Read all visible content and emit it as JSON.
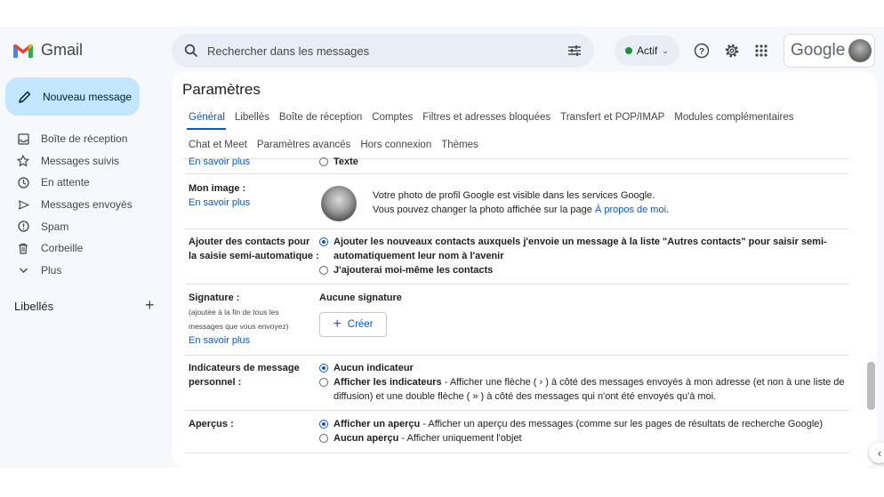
{
  "app": {
    "name": "Gmail"
  },
  "search": {
    "placeholder": "Rechercher dans les messages"
  },
  "status": {
    "label": "Actif"
  },
  "brand": {
    "google": "Google"
  },
  "compose": {
    "label": "Nouveau message"
  },
  "nav": {
    "items": [
      {
        "label": "Boîte de réception",
        "icon": "inbox-icon"
      },
      {
        "label": "Messages suivis",
        "icon": "star-icon"
      },
      {
        "label": "En attente",
        "icon": "clock-icon"
      },
      {
        "label": "Messages envoyés",
        "icon": "send-icon"
      },
      {
        "label": "Spam",
        "icon": "spam-icon"
      },
      {
        "label": "Corbeille",
        "icon": "trash-icon"
      },
      {
        "label": "Plus",
        "icon": "chevron-down-icon"
      }
    ]
  },
  "labels": {
    "title": "Libellés"
  },
  "settings": {
    "title": "Paramètres",
    "tabs_row1": [
      "Général",
      "Libellés",
      "Boîte de réception",
      "Comptes",
      "Filtres et adresses bloquées",
      "Transfert et POP/IMAP",
      "Modules complémentaires"
    ],
    "tabs_row2": [
      "Chat et Meet",
      "Paramètres avancés",
      "Hors connexion",
      "Thèmes"
    ],
    "top": {
      "learn_more": "En savoir plus",
      "option": "Texte"
    },
    "my_image": {
      "label": "Mon image :",
      "learn_more": "En savoir plus",
      "line1": "Votre photo de profil Google est visible dans les services Google.",
      "line2": "Vous pouvez changer la photo affichée sur la page",
      "link": "À propos de moi",
      "period": "."
    },
    "contacts": {
      "label_line1": "Ajouter des contacts pour",
      "label_line2": "la saisie semi-automatique :",
      "opt1": "Ajouter les nouveaux contacts auxquels j'envoie un message à la liste \"Autres contacts\" pour saisir semi-automatiquement leur nom à l'avenir",
      "opt2": "J'ajouterai moi-même les contacts"
    },
    "signature": {
      "label": "Signature :",
      "note1": "(ajoutée à la fin de tous les",
      "note2": "messages que vous envoyez)",
      "learn_more": "En savoir plus",
      "none": "Aucune signature",
      "create": "Créer"
    },
    "indicators": {
      "label_line1": "Indicateurs de message",
      "label_line2": "personnel :",
      "opt1": "Aucun indicateur",
      "opt2_bold": "Afficher les indicateurs",
      "opt2_rest": " - Afficher une flèche ( › ) à côté des messages envoyés à mon adresse (et non à une liste de diffusion) et une double flèche ( » ) à côté des messages qui n'ont été envoyés qu'à moi."
    },
    "previews": {
      "label": "Aperçus :",
      "opt1_bold": "Afficher un aperçu",
      "opt1_rest": " - Afficher un aperçu des messages (comme sur les pages de résultats de recherche Google)",
      "opt2_bold": "Aucun aperçu",
      "opt2_rest": " - Afficher uniquement l'objet"
    }
  },
  "colors": {
    "accent": "#0b57d0",
    "compose_bg": "#c2e7ff",
    "app_bg": "#f6f8fc",
    "status_green": "#1e8e3e"
  }
}
